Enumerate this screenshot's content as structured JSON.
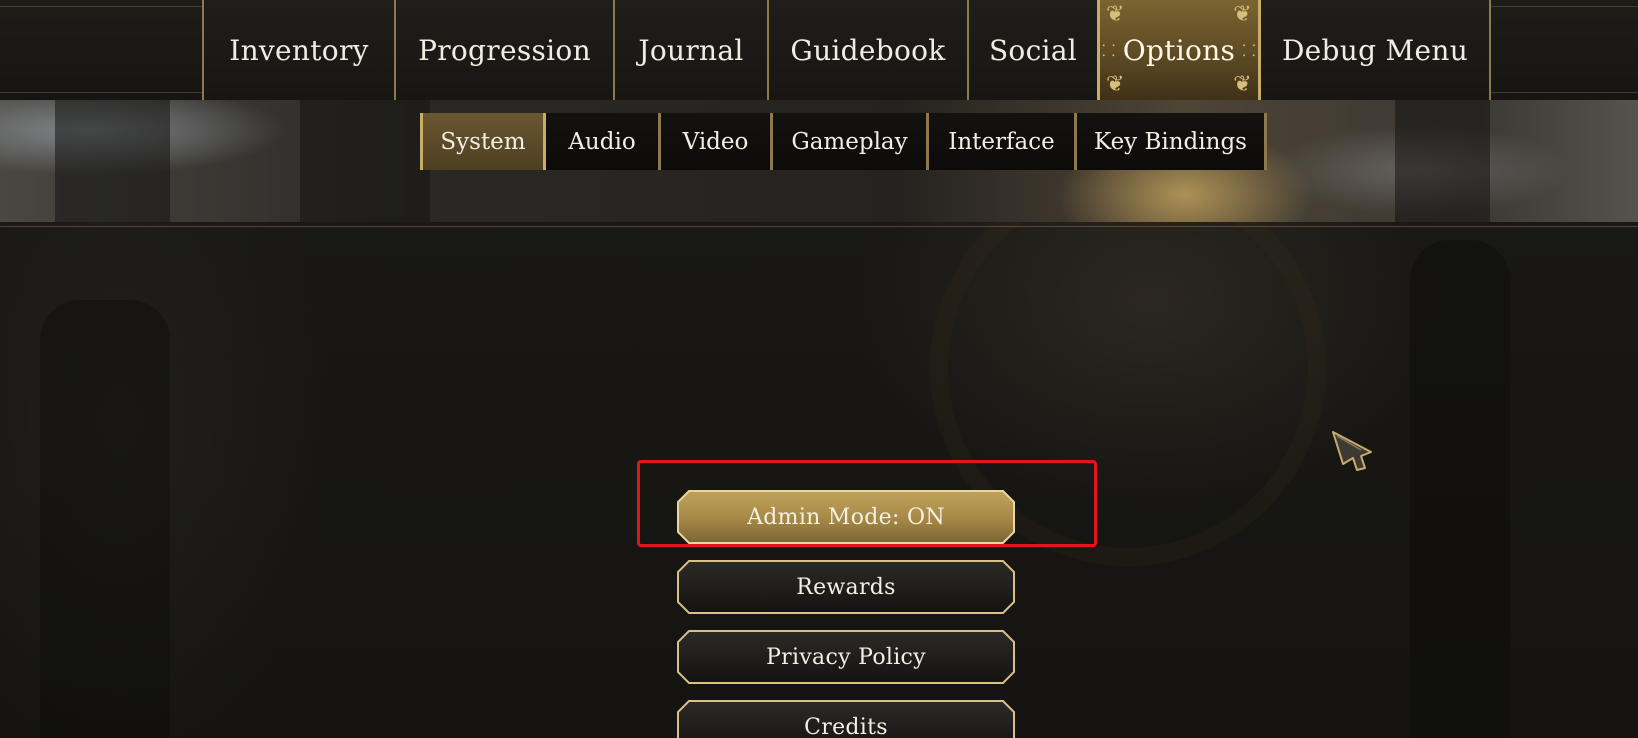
{
  "main_tabs": [
    {
      "label": "Inventory",
      "active": false
    },
    {
      "label": "Progression",
      "active": false
    },
    {
      "label": "Journal",
      "active": false
    },
    {
      "label": "Guidebook",
      "active": false
    },
    {
      "label": "Social",
      "active": false
    },
    {
      "label": "Options",
      "active": true
    },
    {
      "label": "Debug Menu",
      "active": false
    }
  ],
  "sub_tabs": [
    {
      "label": "System",
      "active": true
    },
    {
      "label": "Audio",
      "active": false
    },
    {
      "label": "Video",
      "active": false
    },
    {
      "label": "Gameplay",
      "active": false
    },
    {
      "label": "Interface",
      "active": false
    },
    {
      "label": "Key Bindings",
      "active": false
    }
  ],
  "system_menu": [
    {
      "label": "Admin Mode: ON",
      "selected": true
    },
    {
      "label": "Rewards",
      "selected": false
    },
    {
      "label": "Privacy Policy",
      "selected": false
    },
    {
      "label": "Credits",
      "selected": false
    }
  ],
  "colors": {
    "gold_accent": "#c8ad6a",
    "active_tab": "#7a6431",
    "selected_button": "#a88b48",
    "highlight_annotation": "#e4141c"
  },
  "icons": {
    "pointer": "arrowhead-cursor-icon",
    "tab_ornament": "scroll-flourish-icon"
  }
}
